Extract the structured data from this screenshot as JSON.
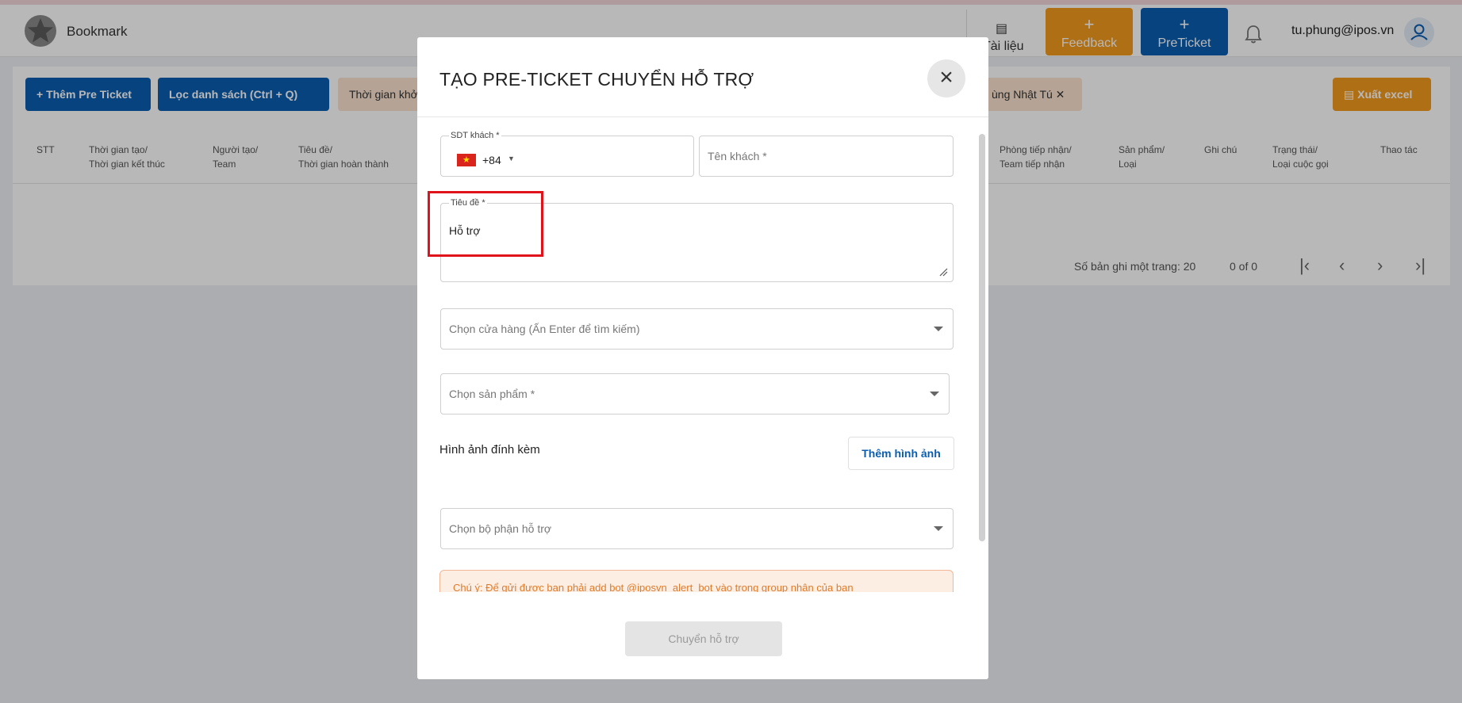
{
  "app": {
    "title": "Bookmark"
  },
  "header": {
    "docs_label": "Tài liệu",
    "feedback_label": "Feedback",
    "preticket_label": "PreTicket",
    "user_email": "tu.phung@ipos.vn",
    "colors": {
      "feedback": "#f39a1e",
      "preticket": "#0a5db0"
    }
  },
  "toolbar": {
    "add_label": "+ Thêm Pre Ticket",
    "filter_label": "Lọc danh sách (Ctrl + Q)",
    "chip_time_label": "Thời gian khởi",
    "chip_person_label": "ùng Nhật Tú ✕",
    "excel_label": "Xuất excel"
  },
  "table": {
    "columns": [
      {
        "l1": "STT",
        "l2": ""
      },
      {
        "l1": "Thời gian tạo/",
        "l2": "Thời gian kết thúc"
      },
      {
        "l1": "Người tạo/",
        "l2": "Team"
      },
      {
        "l1": "Tiêu đề/",
        "l2": "Thời gian hoàn thành"
      },
      {
        "l1": "Phòng tiếp nhận/",
        "l2": "Team tiếp nhận"
      },
      {
        "l1": "Sản phẩm/",
        "l2": "Loại"
      },
      {
        "l1": "Ghi chú",
        "l2": ""
      },
      {
        "l1": "Trạng thái/",
        "l2": "Loại cuộc gọi"
      },
      {
        "l1": "Thao tác",
        "l2": ""
      }
    ]
  },
  "pagination": {
    "rows_per_page_label": "Số bản ghi một trang: 20",
    "range_label": "0 of 0"
  },
  "modal": {
    "title": "TẠO PRE-TICKET CHUYỂN HỖ TRỢ",
    "phone_label": "SDT khách *",
    "phone_code": "+84",
    "customer_name_placeholder": "Tên khách *",
    "subject_label": "Tiêu đề *",
    "subject_value": "Hỗ trợ",
    "store_placeholder": "Chọn cửa hàng (Ấn Enter để tìm kiếm)",
    "product_placeholder": "Chọn sản phẩm *",
    "images_label": "Hình ảnh đính kèm",
    "add_image_label": "Thêm hình ảnh",
    "department_placeholder": "Chọn bộ phận hỗ trợ",
    "note_text": "Chú ý: Để gửi được bạn phải add bot @iposvn_alert_bot vào trong group nhận của bạn",
    "submit_label": "Chuyển hỗ trợ"
  }
}
